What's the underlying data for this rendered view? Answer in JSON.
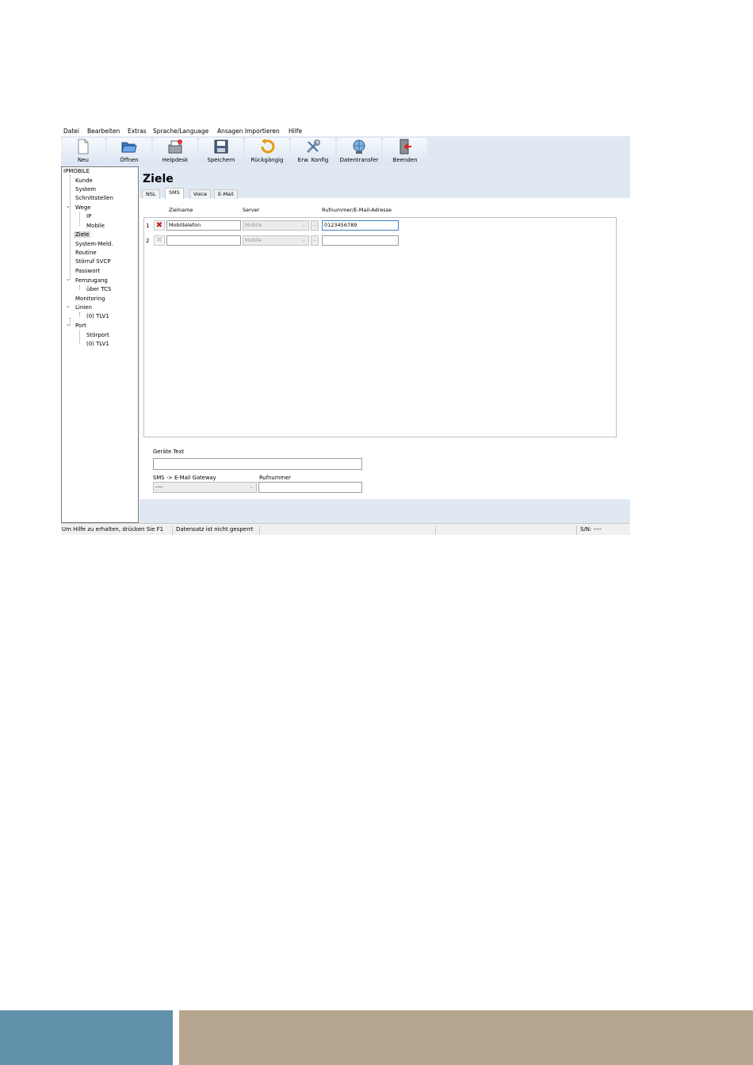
{
  "menu": [
    "Datei",
    "Bearbeiten",
    "Extras",
    "Sprache/Language",
    "Ansagen Importieren",
    "Hilfe"
  ],
  "toolbar": [
    {
      "label": "Neu",
      "icon": "new-document-icon"
    },
    {
      "label": "Öffnen",
      "icon": "open-folder-icon"
    },
    {
      "label": "Helpdesk",
      "icon": "helpdesk-icon"
    },
    {
      "label": "Speichern",
      "icon": "save-disk-icon"
    },
    {
      "label": "Rückgängig",
      "icon": "undo-icon"
    },
    {
      "label": "Erw. Konfig",
      "icon": "tools-icon"
    },
    {
      "label": "Datentransfer",
      "icon": "data-transfer-icon"
    },
    {
      "label": "Beenden",
      "icon": "exit-door-icon"
    }
  ],
  "tree": {
    "root": "IPMOBILE",
    "items": [
      "Kunde",
      "System",
      "Schnittstellen",
      "Wege",
      "IP",
      "Mobile",
      "Ziele",
      "System-Meld.",
      "Routine",
      "Störruf SVCP",
      "Passwort",
      "Fernzugang",
      "über TCS",
      "Monitoring",
      "Linien",
      "(0) TLV1",
      "Port",
      "Störport",
      "(0) TLV1"
    ]
  },
  "main": {
    "title": "Ziele",
    "tabs": [
      "NSL",
      "SMS",
      "Voice",
      "E-Mail"
    ],
    "columns": {
      "name": "Zielname",
      "server": "Server",
      "number": "Rufnummer/E-Mail-Adresse"
    },
    "rows": [
      {
        "num": "1",
        "name": "Mobiltelefon",
        "server": "Mobile",
        "number": "0123456789"
      },
      {
        "num": "2",
        "name": "",
        "server": "Mobile",
        "number": ""
      }
    ],
    "ellipsis": "...",
    "device_text_label": "Geräte Text",
    "device_text_value": "",
    "gateway_label": "SMS -> E-Mail Gateway",
    "gateway_value": "----",
    "phone_label": "Rufnummer",
    "phone_value": ""
  },
  "status": {
    "help": "Um Hilfe zu erhalten, drücken Sie F1",
    "lock": "Datensatz ist nicht gesperrt",
    "serial": "S/N: ----"
  },
  "colors": {
    "toolbar_bg": "#dfe8f3",
    "band_left": "#6191ab",
    "band_right": "#b7a68f"
  }
}
